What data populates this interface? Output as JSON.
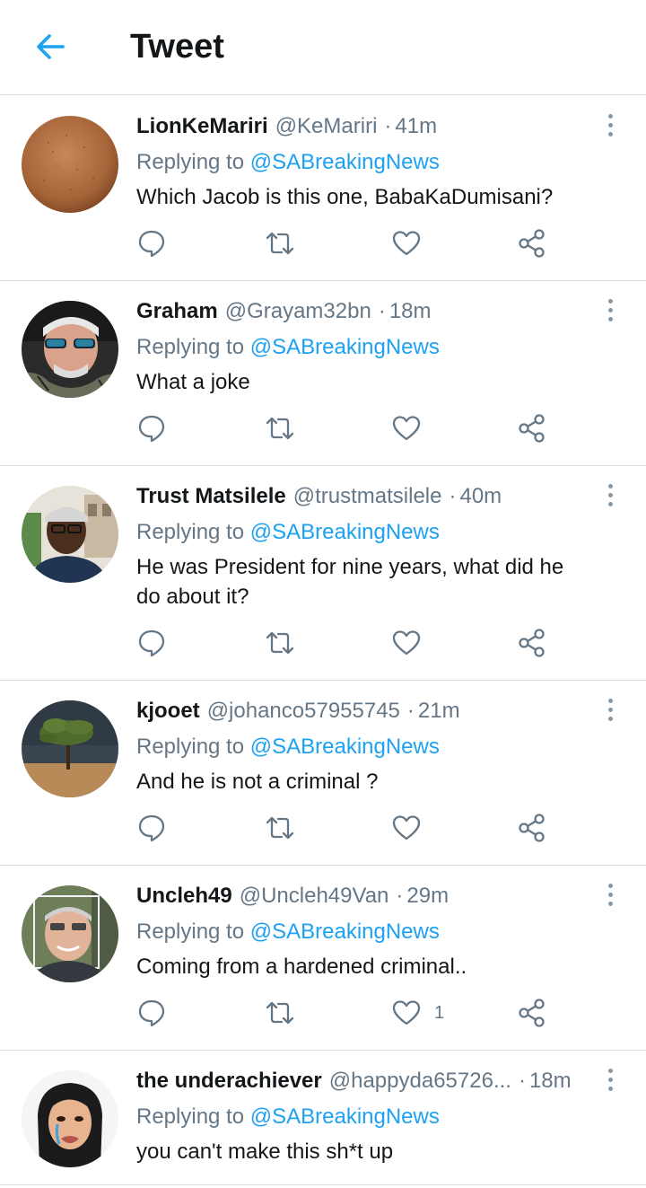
{
  "header": {
    "title": "Tweet",
    "back_icon": "arrow-left-icon",
    "accent": "#1da1f2"
  },
  "colors": {
    "name": "#14171a",
    "meta": "#657786",
    "link": "#1da1f2",
    "icon": "#657786",
    "divider": "#d9dde1"
  },
  "tweets": [
    {
      "name": "LionKeMariri",
      "handle": "@KeMariri",
      "time": "41m",
      "reply_label": "Replying to",
      "reply_to": "@SABreakingNews",
      "text": "Which Jacob is this one, BabaKaDumisani?",
      "like_count": ""
    },
    {
      "name": "Graham",
      "handle": "@Grayam32bn",
      "time": "18m",
      "reply_label": "Replying to",
      "reply_to": "@SABreakingNews",
      "text": "What a joke",
      "like_count": ""
    },
    {
      "name": "Trust Matsilele",
      "handle": "@trustmatsilele",
      "time": "40m",
      "reply_label": "Replying to",
      "reply_to": "@SABreakingNews",
      "text": "He was President for nine years, what did he do about it?",
      "like_count": ""
    },
    {
      "name": "kjooet",
      "handle": "@johanco57955745",
      "time": "21m",
      "reply_label": "Replying to",
      "reply_to": "@SABreakingNews",
      "text": "And he is not a criminal ?",
      "like_count": ""
    },
    {
      "name": "Uncleh49",
      "handle": "@Uncleh49Van",
      "time": "29m",
      "reply_label": "Replying to",
      "reply_to": "@SABreakingNews",
      "text": "Coming from a hardened criminal..",
      "like_count": "1"
    },
    {
      "name": "the underachiever",
      "handle": "@happyda65726...",
      "time": "18m",
      "reply_label": "Replying to",
      "reply_to": "@SABreakingNews",
      "text": "you can't make this sh*t up",
      "like_count": ""
    }
  ]
}
